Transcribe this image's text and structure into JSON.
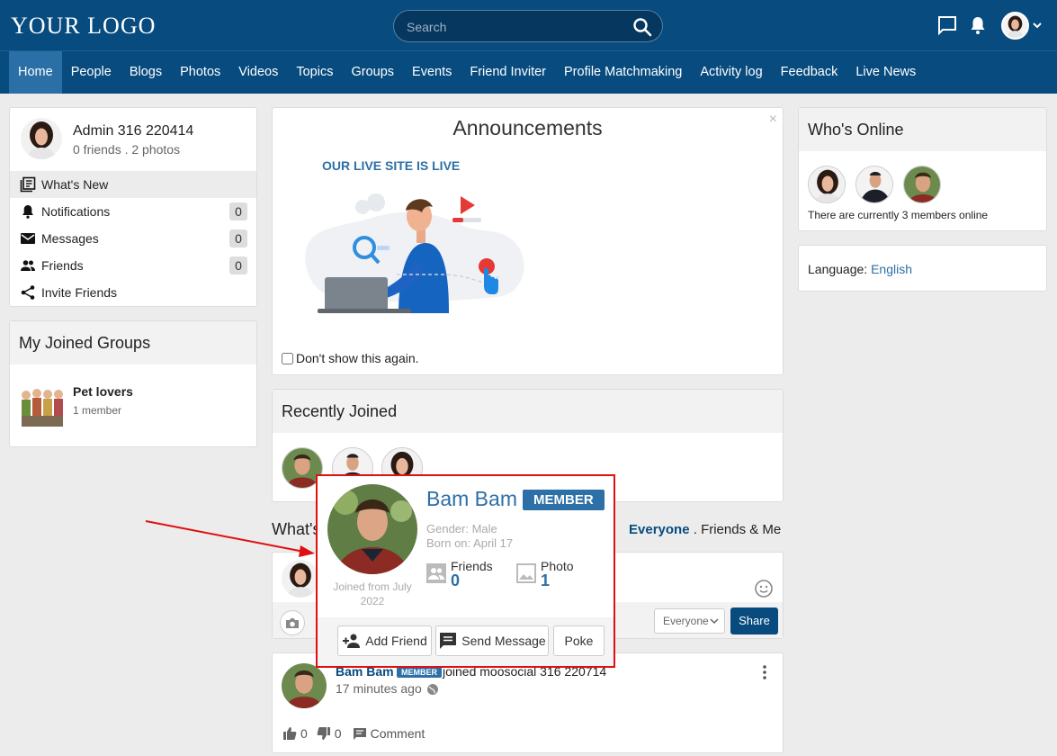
{
  "header": {
    "logo": "YOUR LOGO",
    "search_placeholder": "Search",
    "nav": [
      "Home",
      "People",
      "Blogs",
      "Photos",
      "Videos",
      "Topics",
      "Groups",
      "Events",
      "Friend Inviter",
      "Profile Matchmaking",
      "Activity log",
      "Feedback",
      "Live News"
    ],
    "active_nav": "Home"
  },
  "profile": {
    "name": "Admin 316 220414",
    "meta": "0 friends . 2 photos",
    "menu": [
      {
        "label": "What's New",
        "icon": "newspaper-icon",
        "count": ""
      },
      {
        "label": "Notifications",
        "icon": "bell-icon",
        "count": "0"
      },
      {
        "label": "Messages",
        "icon": "envelope-icon",
        "count": "0"
      },
      {
        "label": "Friends",
        "icon": "people-icon",
        "count": "0"
      },
      {
        "label": "Invite Friends",
        "icon": "share-icon",
        "count": ""
      }
    ]
  },
  "groups": {
    "title": "My Joined Groups",
    "items": [
      {
        "name": "Pet lovers",
        "members": "1 member"
      }
    ]
  },
  "announcement": {
    "title": "Announcements",
    "close": "×",
    "subtitle": "OUR LIVE SITE IS LIVE",
    "checkbox_label": "Don't show this again."
  },
  "recently_joined": {
    "title": "Recently Joined"
  },
  "activity": {
    "title": "What's",
    "filters": {
      "selected": "Everyone",
      "separator": ".",
      "other": "Friends & Me"
    },
    "privacy": "Everyone",
    "share_label": "Share"
  },
  "feed": {
    "name": "Bam Bam",
    "badge": "MEMBER",
    "action": "joined moosocial 316 220714",
    "time": "17 minutes ago",
    "likes": "0",
    "dislikes": "0",
    "comment_label": "Comment"
  },
  "online": {
    "title": "Who's Online",
    "text": "There are currently 3 members online"
  },
  "language": {
    "label": "Language:",
    "value": "English"
  },
  "popup": {
    "name": "Bam Bam",
    "badge": "MEMBER",
    "gender": "Gender: Male",
    "born": "Born on: April 17",
    "friends_label": "Friends",
    "friends_value": "0",
    "photo_label": "Photo",
    "photo_value": "1",
    "joined": "Joined from July 2022",
    "add_friend": "Add Friend",
    "send_message": "Send Message",
    "poke": "Poke"
  },
  "colors": {
    "header_bg": "#074b7f",
    "nav_active": "#2a6fa6",
    "accent": "#2d6fa7",
    "highlight_border": "#e01010"
  }
}
